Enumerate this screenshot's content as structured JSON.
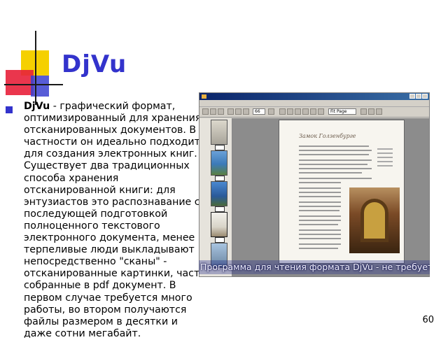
{
  "slide": {
    "title": "DjVu",
    "body_bold": "DjVu",
    "body_text": " - графический формат, оптимизированный для хранения отсканированных документов. В частности он идеально подходит для создания электронных книг. Существует два традиционных способа хранения отсканированной книги: для энтузиастов это распознавание с последующей подготовкой полноценного текстового электронного документа, менее терпеливые люди выкладывают непосредственно \"сканы\" - отсканированные картинки, часто собранные в pdf документ. В первом случае требуется много работы, во втором получаются файлы размером в десятки и даже сотни мегабайт.",
    "caption": "Программа для чтения формата DjVu - не требует установки",
    "page_number": "60"
  },
  "viewer": {
    "zoom": "Fit Page",
    "page_field": "66"
  },
  "colors": {
    "title": "#3333cc",
    "bullet": "#3333cc",
    "deco_yellow": "#f5d000",
    "deco_red": "#e8203a",
    "deco_blue": "#3a40d0"
  }
}
